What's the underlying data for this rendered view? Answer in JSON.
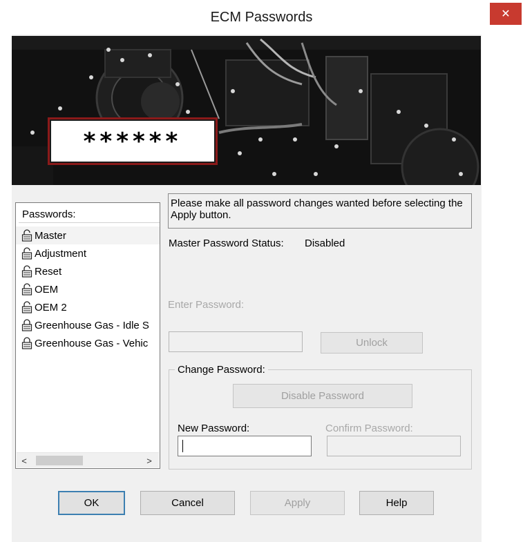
{
  "window": {
    "title": "ECM Passwords",
    "close_glyph": "✕"
  },
  "banner": {
    "password_mask": "******"
  },
  "passwords_list": {
    "header": "Passwords:",
    "items": [
      {
        "label": "Master",
        "icon": "unlocked-padlock-icon"
      },
      {
        "label": "Adjustment",
        "icon": "unlocked-padlock-icon"
      },
      {
        "label": "Reset",
        "icon": "unlocked-padlock-icon"
      },
      {
        "label": "OEM",
        "icon": "unlocked-padlock-icon"
      },
      {
        "label": "OEM 2",
        "icon": "unlocked-padlock-icon"
      },
      {
        "label": "Greenhouse Gas - Idle S",
        "icon": "locked-padlock-icon"
      },
      {
        "label": "Greenhouse Gas - Vehic",
        "icon": "locked-padlock-icon"
      }
    ],
    "selected": "Master",
    "scroll_left_glyph": "<",
    "scroll_right_glyph": ">"
  },
  "info": {
    "message": "Please make all password changes wanted before selecting the Apply button."
  },
  "status": {
    "label": "Master Password Status:",
    "value": "Disabled"
  },
  "enter_password": {
    "label": "Enter Password:",
    "value": "",
    "unlock_label": "Unlock"
  },
  "change_password": {
    "group_label": "Change Password:",
    "disable_label": "Disable Password",
    "new_label": "New Password:",
    "new_value": "",
    "confirm_label": "Confirm Password:",
    "confirm_value": ""
  },
  "buttons": {
    "ok": "OK",
    "cancel": "Cancel",
    "apply": "Apply",
    "help": "Help"
  },
  "colors": {
    "close_button": "#c83a2f",
    "dialog_background": "#f0f0f0",
    "disabled_text": "#a8a8a8",
    "sign_border": "#8b1a1a"
  }
}
